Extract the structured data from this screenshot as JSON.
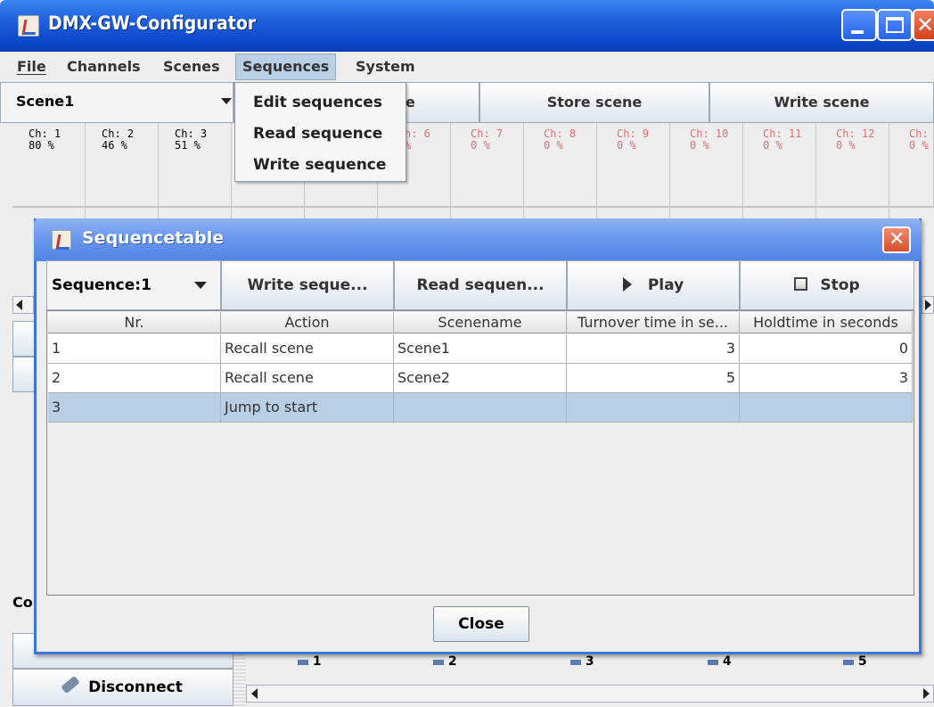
{
  "window": {
    "title": "DMX-GW-Configurator"
  },
  "menubar": {
    "items": [
      {
        "label": "File"
      },
      {
        "label": "Channels"
      },
      {
        "label": "Scenes"
      },
      {
        "label": "Sequences"
      },
      {
        "label": "System"
      }
    ]
  },
  "sequences_menu": {
    "items": [
      {
        "label": "Edit sequences"
      },
      {
        "label": "Read sequence"
      },
      {
        "label": "Write sequence"
      }
    ]
  },
  "toolbar": {
    "scene_selected": "Scene1",
    "partial_button": "e",
    "store_scene": "Store scene",
    "write_scene": "Write scene"
  },
  "channels": [
    {
      "name": "Ch: 1",
      "value": "80 %",
      "active": true
    },
    {
      "name": "Ch: 2",
      "value": "46 %",
      "active": true
    },
    {
      "name": "Ch: 3",
      "value": "51 %",
      "active": true
    },
    {
      "name": "h: 6",
      "value": "%",
      "active": false
    },
    {
      "name": "Ch: 7",
      "value": "0 %",
      "active": false
    },
    {
      "name": "Ch: 8",
      "value": "0 %",
      "active": false
    },
    {
      "name": "Ch: 9",
      "value": "0 %",
      "active": false
    },
    {
      "name": "Ch: 10",
      "value": "0 %",
      "active": false
    },
    {
      "name": "Ch: 11",
      "value": "0 %",
      "active": false
    },
    {
      "name": "Ch: 12",
      "value": "0 %",
      "active": false
    },
    {
      "name": "Ch:",
      "value": "0 %",
      "active": false
    }
  ],
  "left_panel": {
    "partial_label": "Coi",
    "disconnect_label": "Disconnect"
  },
  "bottom_checkboxes": [
    "1",
    "2",
    "3",
    "4",
    "5"
  ],
  "dialog": {
    "title": "Sequencetable",
    "sequence_selected": "Sequence:1",
    "write_button": "Write seque...",
    "read_button": "Read sequen...",
    "play_button": "Play",
    "stop_button": "Stop",
    "close_button": "Close",
    "columns": [
      "Nr.",
      "Action",
      "Scenename",
      "Turnover time in se...",
      "Holdtime in seconds"
    ],
    "rows": [
      {
        "nr": "1",
        "action": "Recall scene",
        "scene": "Scene1",
        "turnover": "3",
        "hold": "0",
        "selected": false
      },
      {
        "nr": "2",
        "action": "Recall scene",
        "scene": "Scene2",
        "turnover": "5",
        "hold": "3",
        "selected": false
      },
      {
        "nr": "3",
        "action": "Jump to start",
        "scene": "",
        "turnover": "",
        "hold": "",
        "selected": true
      }
    ]
  }
}
